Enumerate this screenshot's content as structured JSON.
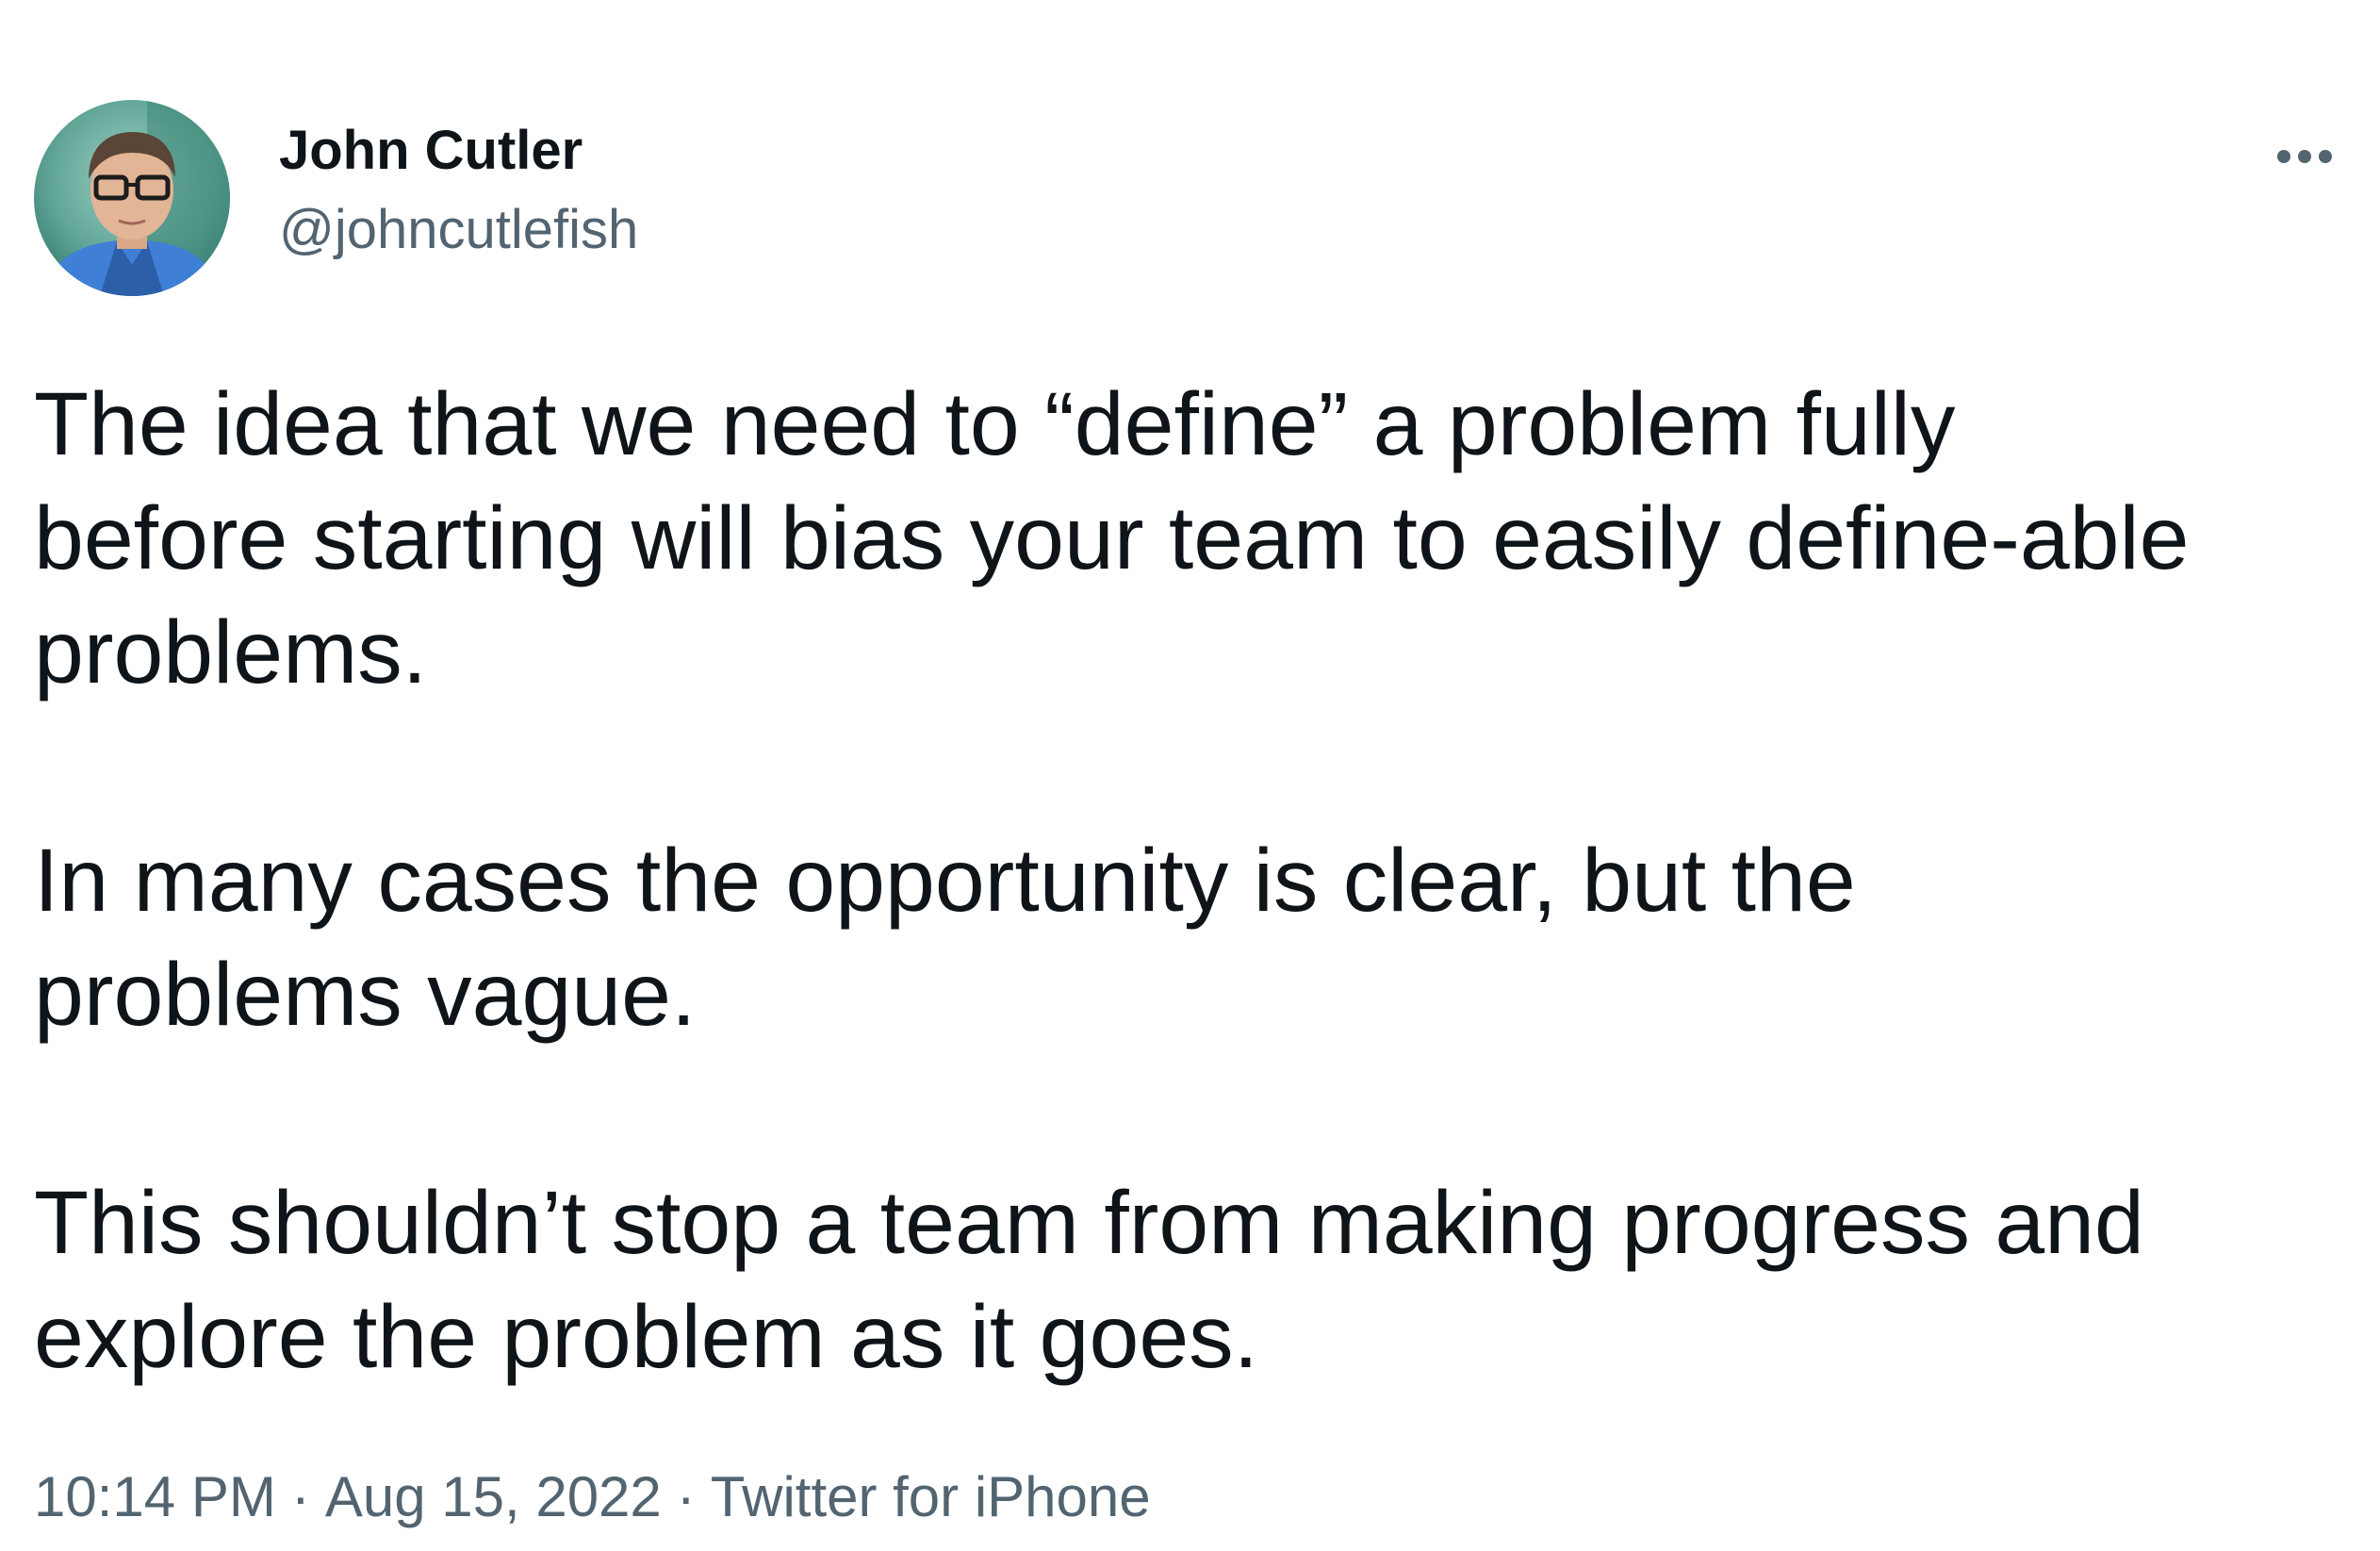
{
  "author": {
    "display_name": "John Cutler",
    "handle": "@johncutlefish"
  },
  "tweet": {
    "paragraphs": [
      {
        "lines": [
          "The idea that we need to “define” a problem fully",
          "before starting will bias your team to easily define-able",
          "problems."
        ]
      },
      {
        "lines": [
          "In many cases the opportunity is clear, but the",
          "problems vague."
        ]
      },
      {
        "lines": [
          "This shouldn’t stop a team from making progress and",
          "explore the problem as it goes."
        ]
      }
    ]
  },
  "meta": {
    "time": "10:14 PM",
    "separator": "·",
    "date": "Aug 15, 2022",
    "source": "Twitter for iPhone"
  },
  "icons": {
    "more": "more-horizontal-icon",
    "avatar": "user-avatar"
  },
  "colors": {
    "text_primary": "#0f1419",
    "text_secondary": "#536471",
    "background": "#ffffff"
  }
}
